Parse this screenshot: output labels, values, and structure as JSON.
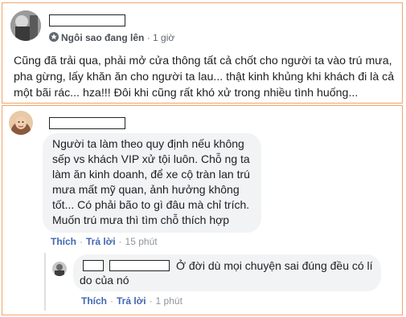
{
  "post": {
    "author_badge": "Ngôi sao đang lên",
    "separator": "·",
    "time": "1 giờ",
    "text": "Cũng đã trải qua, phải mở cửa thông tất cả chốt cho người ta vào trú mưa, pha gừng, lấy khăn ăn cho người ta lau... thật kinh khủng khi khách đi là cả một bãi rác... hza!!! Đôi khi cũng rất khó xử trong nhiều tình huống..."
  },
  "comment": {
    "text": "Người ta làm theo quy định nếu không sếp vs khách  VIP xử tội luôn. Chỗ ng ta làm ăn kinh doanh, để xe cộ tràn lan trú mưa mất mỹ quan, ảnh hưởng không tốt... Có phải bão to gì đâu mà chỉ trích. Muốn trú mưa thì tìm chỗ thích hợp",
    "like_label": "Thích",
    "reply_label": "Trả lời",
    "separator": "·",
    "time": "15 phút"
  },
  "reply": {
    "text": "Ở đời dù mọi chuyện sai đúng đều có lí do của nó",
    "like_label": "Thích",
    "reply_label": "Trả lời",
    "separator": "·",
    "time": "1 phút"
  },
  "colors": {
    "card_border": "#f0a56a",
    "link": "#4267b2",
    "meta": "#90949c",
    "bubble": "#f2f3f5"
  }
}
